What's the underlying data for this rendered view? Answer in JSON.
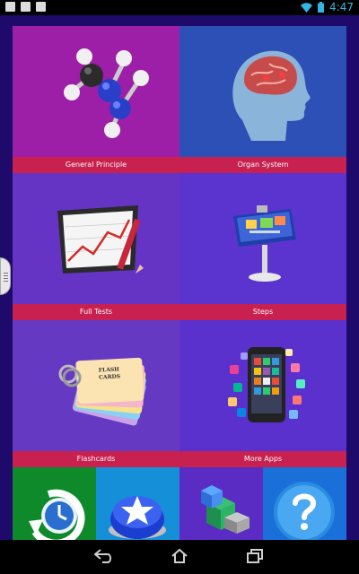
{
  "status_bar": {
    "time": "4:47"
  },
  "tiles": [
    {
      "label": "General Principle",
      "icon": "molecule-icon"
    },
    {
      "label": "Organ System",
      "icon": "brain-head-icon"
    },
    {
      "label": "Full Tests",
      "icon": "chart-board-icon"
    },
    {
      "label": "Steps",
      "icon": "presentation-stand-icon"
    },
    {
      "label": "Flashcards",
      "icon": "flash-cards-icon"
    },
    {
      "label": "More Apps",
      "icon": "smartphone-apps-icon"
    }
  ],
  "flashcard_text": {
    "line1": "FLASH",
    "line2": "CARDS"
  },
  "bottom_row": [
    {
      "icon": "clock-icon"
    },
    {
      "icon": "star-button-icon"
    },
    {
      "icon": "3d-cubes-icon"
    },
    {
      "icon": "help-icon"
    }
  ],
  "colors": {
    "app_background": "#1d0a6b",
    "caption_bar": "#c8204f",
    "tile_general": "#9d1fa8",
    "tile_organ": "#2d50b6",
    "tile_tests": "#6634c4",
    "tile_steps": "#5b33cf",
    "tile_flash": "#6539c2",
    "tile_more": "#5a31cc",
    "status_accent": "#33b5e5"
  }
}
